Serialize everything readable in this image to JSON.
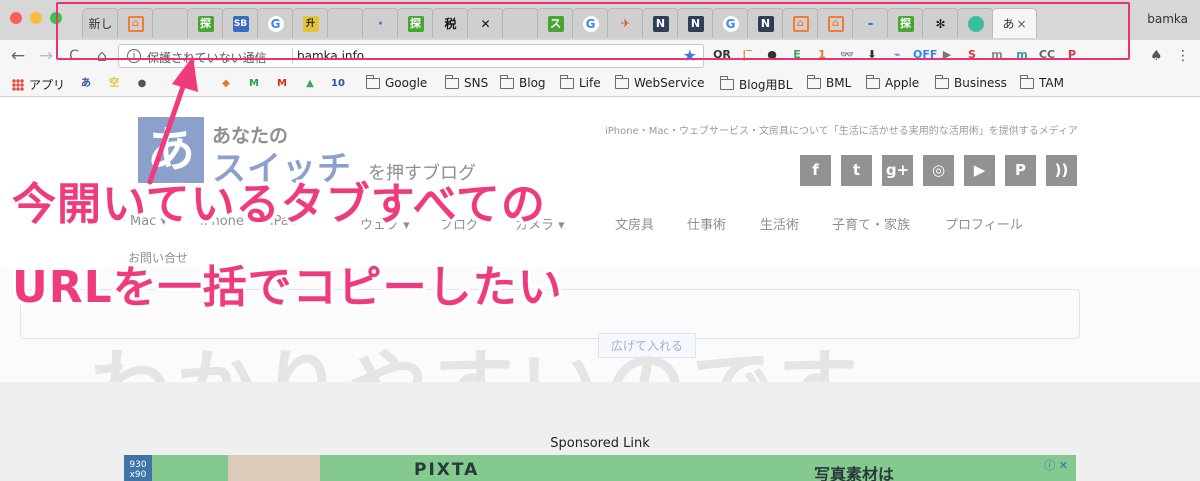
{
  "window": {
    "profile_name": "bamka",
    "tabs": [
      {
        "kind": "text",
        "label": "新し"
      },
      {
        "kind": "house",
        "glyph": "⌂"
      },
      {
        "kind": "page",
        "glyph": ""
      },
      {
        "kind": "green",
        "glyph": "探"
      },
      {
        "kind": "blue",
        "glyph": "SB"
      },
      {
        "kind": "google",
        "glyph": "G"
      },
      {
        "kind": "jp",
        "glyph": "升"
      },
      {
        "kind": "page",
        "glyph": ""
      },
      {
        "kind": "dot",
        "glyph": "·"
      },
      {
        "kind": "green",
        "glyph": "探"
      },
      {
        "kind": "dark",
        "glyph": "税"
      },
      {
        "kind": "dark",
        "glyph": "✕"
      },
      {
        "kind": "page",
        "glyph": ""
      },
      {
        "kind": "green",
        "glyph": "ス"
      },
      {
        "kind": "google",
        "glyph": "G"
      },
      {
        "kind": "bird",
        "glyph": "✈"
      },
      {
        "kind": "blueN",
        "glyph": "N"
      },
      {
        "kind": "blueN",
        "glyph": "N"
      },
      {
        "kind": "google",
        "glyph": "G"
      },
      {
        "kind": "blueN",
        "glyph": "N"
      },
      {
        "kind": "house",
        "glyph": "⌂"
      },
      {
        "kind": "house",
        "glyph": "⌂"
      },
      {
        "kind": "dot",
        "glyph": "-"
      },
      {
        "kind": "green",
        "glyph": "探"
      },
      {
        "kind": "dark",
        "glyph": "✻"
      },
      {
        "kind": "teal",
        "glyph": ""
      }
    ],
    "active_tab": {
      "label": "あ",
      "close": "×"
    }
  },
  "toolbar": {
    "back": "←",
    "forward": "→",
    "reload": "C",
    "home": "⌂",
    "security_label": "保護されていない通信",
    "url": "bamka.info",
    "star": "★",
    "extensions": [
      "QR",
      "|‾",
      "●",
      "E",
      "1",
      "👓",
      "⬇",
      "⌁",
      "OFF",
      "▶",
      "S",
      "m",
      "m",
      "CC",
      "P"
    ],
    "extension_colors": [
      "#333333",
      "#d08a2b",
      "#333333",
      "#3aa757",
      "#e27b1e",
      "#333333",
      "#333333",
      "#4a7fd4",
      "#2d8ae0",
      "#777777",
      "#d9392c",
      "#888888",
      "#2fa0a8",
      "#666666",
      "#d8343f"
    ]
  },
  "bookmarks": {
    "apps": "アプリ",
    "icons": [
      "あ",
      "空",
      "●",
      "",
      "",
      "◆",
      "M",
      "M",
      "▲",
      "10"
    ],
    "folders": [
      "Google",
      "SNS",
      "Blog",
      "Life",
      "WebService",
      "Blog用BL",
      "BML",
      "Apple",
      "Business",
      "TAM"
    ]
  },
  "site": {
    "logo_mark": "あ",
    "logo_line1": "あなたの",
    "logo_line2": "スイッチ",
    "logo_line3": "を押すブログ",
    "tagline": "iPhone・Mac・ウェブサービス・文房具について「生活に活かせる実用的な活用術」を提供するメディア",
    "social": [
      "f",
      "t",
      "g+",
      "◎",
      "▶",
      "P",
      "))"
    ],
    "nav": [
      "Mac ▾",
      "iPhone ▾",
      "iPad",
      "ウェブ ▾",
      "ブログ",
      "カメラ ▾",
      "文房具",
      "仕事術",
      "生活術",
      "子育て・家族",
      "プロフィール"
    ],
    "nav_contact": "お問い合せ",
    "hero_badge": "広げて入れる",
    "hero_big": "わかりやすいのです",
    "sponsored": "Sponsored Link",
    "ad": {
      "thumb": "930 x90",
      "brand": "PIXTA",
      "copy": "写真素材は",
      "info": "ⓘ ✕"
    }
  },
  "annotation": {
    "line1": "今開いているタブすべての",
    "line2": "URLを一括でコピーしたい",
    "color": "#ef3b7d"
  }
}
